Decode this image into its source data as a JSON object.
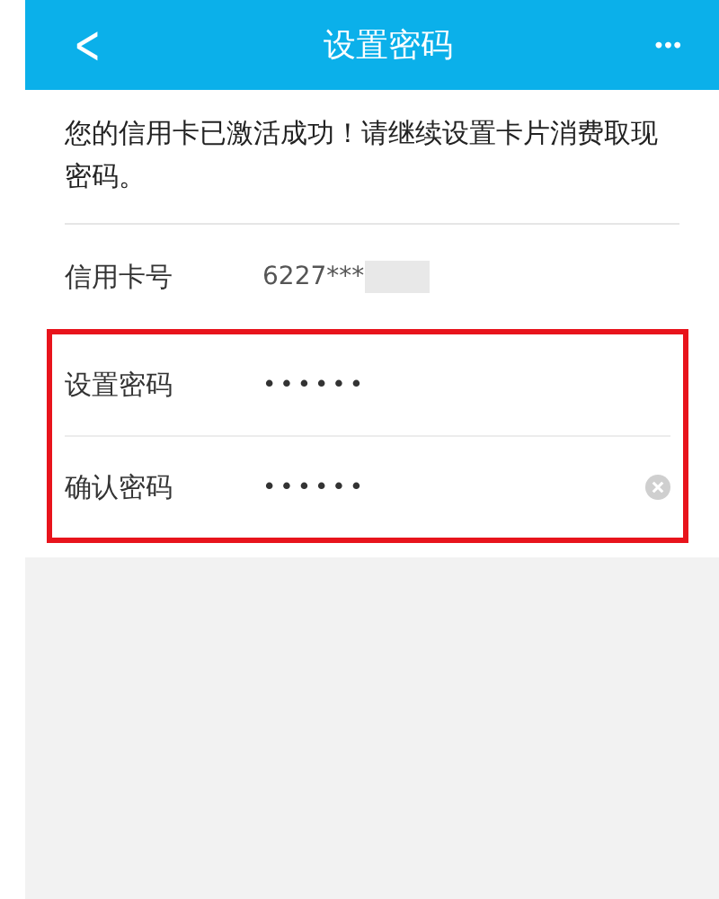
{
  "header": {
    "back": "<",
    "title": "设置密码",
    "more": "•••"
  },
  "message": "您的信用卡已激活成功！请继续设置卡片消费取现密码。",
  "card": {
    "label": "信用卡号",
    "value": "6227***",
    "redacted": true
  },
  "fields": [
    {
      "label": "设置密码",
      "value": "••••••",
      "clearable": false
    },
    {
      "label": "确认密码",
      "value": "••••••",
      "clearable": true
    }
  ],
  "highlighted": true
}
